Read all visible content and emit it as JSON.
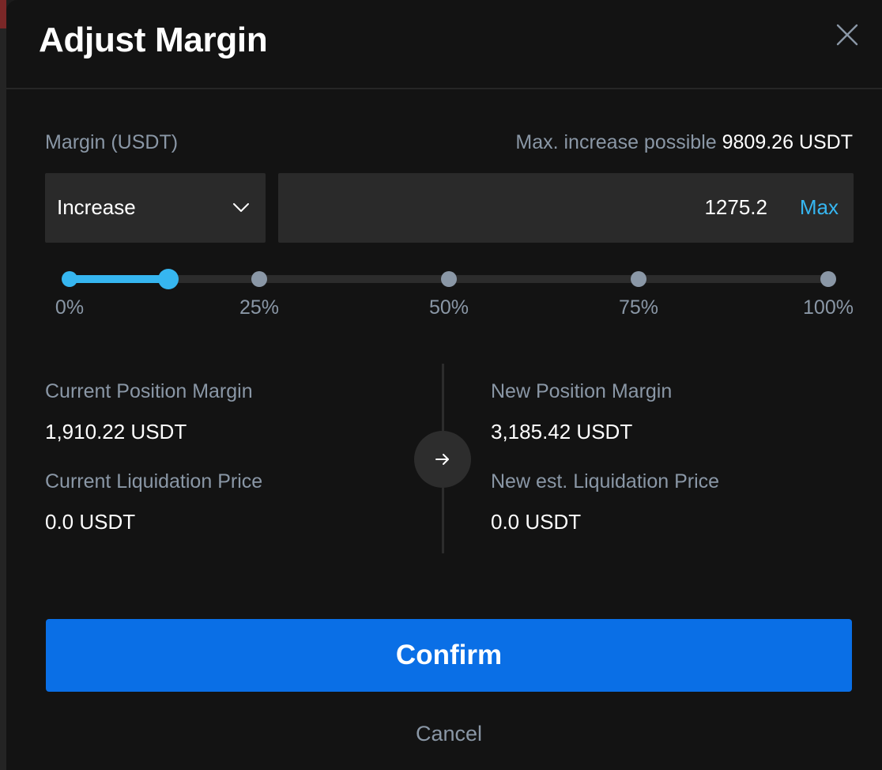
{
  "dialog": {
    "title": "Adjust Margin",
    "close_icon": "close-icon"
  },
  "margin": {
    "label": "Margin (USDT)",
    "max_label": "Max. increase possible",
    "max_value": "9809.26 USDT",
    "mode": {
      "selected": "Increase",
      "icon": "chevron-down-icon"
    },
    "amount": "1275.2",
    "max_button": "Max"
  },
  "slider": {
    "value_fraction": 0.13,
    "ticks": [
      "0%",
      "25%",
      "50%",
      "75%",
      "100%"
    ]
  },
  "summary": {
    "current_margin_label": "Current Position Margin",
    "current_margin_value": "1,910.22 USDT",
    "current_liq_label": "Current Liquidation Price",
    "current_liq_value": "0.0 USDT",
    "new_margin_label": "New Position Margin",
    "new_margin_value": "3,185.42 USDT",
    "new_liq_label": "New est. Liquidation Price",
    "new_liq_value": "0.0 USDT",
    "arrow_icon": "arrow-right-icon"
  },
  "actions": {
    "confirm": "Confirm",
    "cancel": "Cancel"
  },
  "colors": {
    "accent": "#36b6f0",
    "primary_button": "#0a6fe6",
    "muted_text": "#8a97a6",
    "background": "#131313"
  }
}
